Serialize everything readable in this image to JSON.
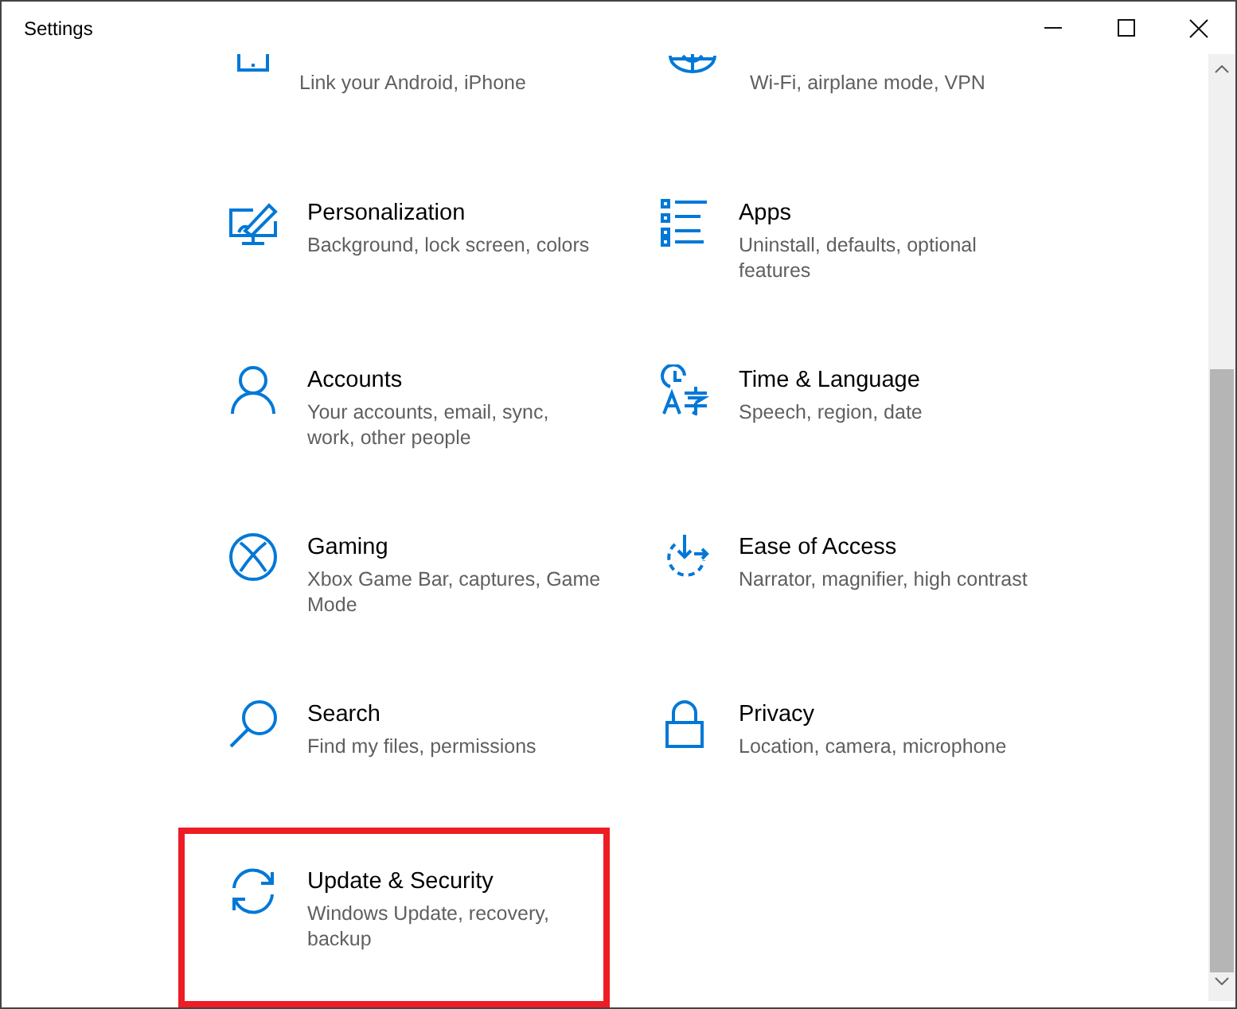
{
  "window": {
    "title": "Settings"
  },
  "tiles": [
    {
      "kind": "partial",
      "description": "Link your Android, iPhone",
      "highlighted": false
    },
    {
      "kind": "partial",
      "description": "Wi-Fi, airplane mode, VPN",
      "highlighted": false
    },
    {
      "kind": "full",
      "title": "Personalization",
      "description": "Background, lock screen, colors",
      "highlighted": false
    },
    {
      "kind": "full",
      "title": "Apps",
      "description": "Uninstall, defaults, optional features",
      "highlighted": false
    },
    {
      "kind": "full",
      "title": "Accounts",
      "description": "Your accounts, email, sync, work, other people",
      "highlighted": false
    },
    {
      "kind": "full",
      "title": "Time & Language",
      "description": "Speech, region, date",
      "highlighted": false
    },
    {
      "kind": "full",
      "title": "Gaming",
      "description": "Xbox Game Bar, captures, Game Mode",
      "highlighted": false
    },
    {
      "kind": "full",
      "title": "Ease of Access",
      "description": "Narrator, magnifier, high contrast",
      "highlighted": false
    },
    {
      "kind": "full",
      "title": "Search",
      "description": "Find my files, permissions",
      "highlighted": false
    },
    {
      "kind": "full",
      "title": "Privacy",
      "description": "Location, camera, microphone",
      "highlighted": false
    },
    {
      "kind": "full",
      "title": "Update & Security",
      "description": "Windows Update, recovery, backup",
      "highlighted": true
    }
  ]
}
